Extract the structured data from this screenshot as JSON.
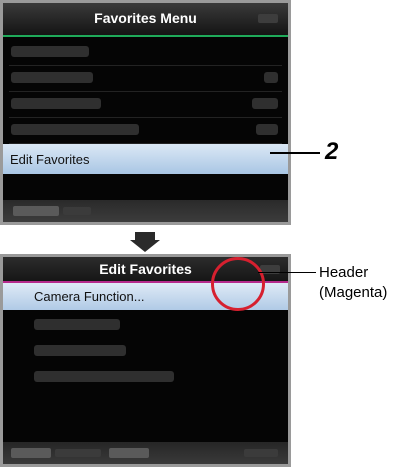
{
  "screen_top": {
    "title": "Favorites Menu",
    "selected_item": "Edit Favorites",
    "accent_color": "#1faa5a"
  },
  "callout": {
    "step_number": "2"
  },
  "screen_bottom": {
    "title": "Edit Favorites",
    "selected_item": "Camera Function...",
    "accent_color": "#b62a8c"
  },
  "annotation": {
    "line1": "Header",
    "line2": "(Magenta)"
  },
  "icons": {
    "transition": "down-arrow-icon",
    "highlight": "circle-highlight-icon"
  }
}
